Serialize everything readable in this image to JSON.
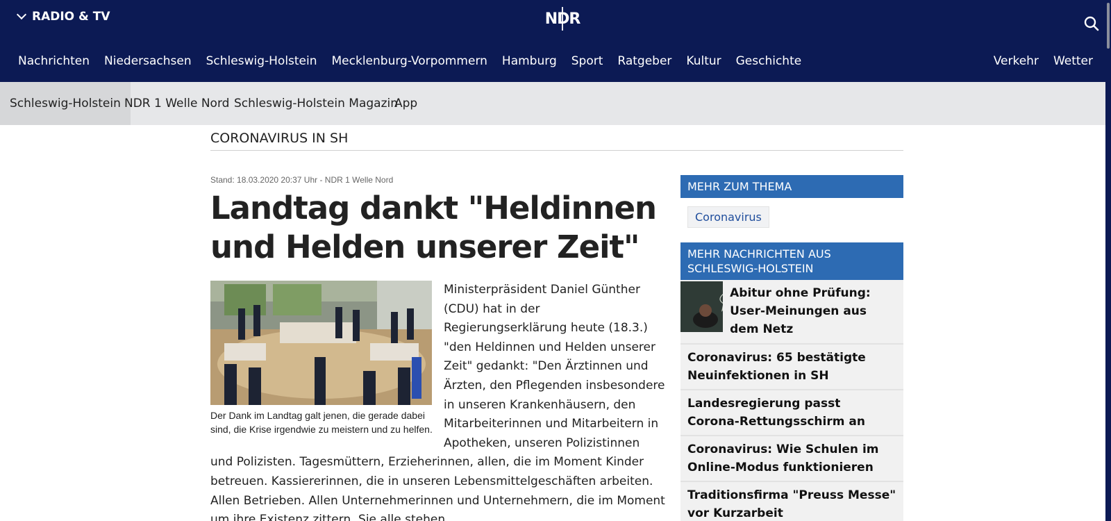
{
  "topbar": {
    "radio_tv": "RADIO & TV",
    "logo": "NDR",
    "nav": [
      "Nachrichten",
      "Niedersachsen",
      "Schleswig-Holstein",
      "Mecklenburg-Vorpommern",
      "Hamburg",
      "Sport",
      "Ratgeber",
      "Kultur",
      "Geschichte"
    ],
    "nav_right": [
      "Verkehr",
      "Wetter"
    ],
    "search_icon": "search-icon",
    "colors": {
      "background": "#0c1a54"
    }
  },
  "subnav": {
    "items": [
      "Schleswig-Holstein",
      "NDR 1 Welle Nord",
      "Schleswig-Holstein Magazin",
      "App"
    ]
  },
  "section": {
    "title": "CORONAVIRUS IN SH"
  },
  "article": {
    "meta": "Stand: 18.03.2020 20:37 Uhr  - NDR 1 Welle Nord",
    "headline": "Landtag dankt \"Heldinnen und Helden unserer Zeit\"",
    "caption": "Der Dank im Landtag galt jenen, die gerade dabei sind, die Krise irgendwie zu meistern und zu helfen.",
    "body": "Ministerpräsident Daniel Günther (CDU) hat in der Regierungserklärung heute (18.3.) \"den Heldinnen und Helden unserer Zeit\" gedankt: \"Den Ärztinnen und Ärzten, den Pflegenden insbesondere in unseren Krankenhäusern, den Mitarbeiterinnen und Mitarbeitern in Apotheken, unseren Polizistinnen und Polizisten. Tagesmüttern, Erzieherinnen, allen, die im Moment Kinder betreuen. Kassiererinnen, die in unseren Lebensmittelgeschäften arbeiten. Allen Betrieben. Allen Unternehmerinnen und Unternehmern, die im Moment um ihre Existenz zittern. Sie alle stehen"
  },
  "sidebar": {
    "topic_head": "MEHR ZUM THEMA",
    "topic_tag": "Coronavirus",
    "news_head": "MEHR NACHRICHTEN AUS SCHLESWIG-HOLSTEIN",
    "feature": "Abitur ohne Prüfung: User-Meinungen aus dem Netz",
    "items": [
      "Coronavirus: 65 bestätigte Neuinfektionen in SH",
      "Landesregierung passt Corona-Rettungsschirm an",
      "Coronavirus: Wie Schulen im Online-Modus funktionieren",
      "Traditionsfirma \"Preuss Messe\" vor Kurzarbeit"
    ],
    "colors": {
      "box_head": "#2d6bb3"
    }
  }
}
